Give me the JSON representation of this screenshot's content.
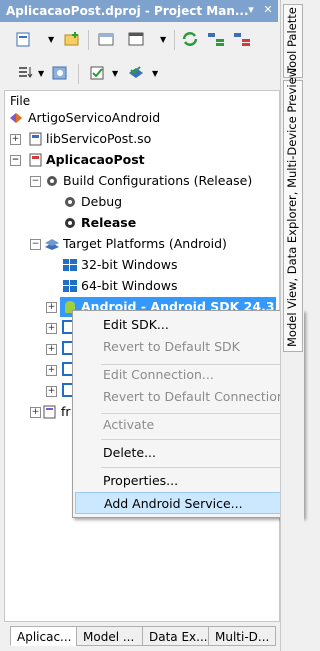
{
  "window": {
    "title": "AplicacaoPost.dproj - Project Man..."
  },
  "toolbar": {
    "icons": [
      "new-item-icon",
      "add-icon",
      "folder-icon",
      "view-icon",
      "sync-icon",
      "expand-icon",
      "collapse-icon",
      "sort-icon",
      "project-manager-icon",
      "build-config-icon",
      "target-platform-icon"
    ]
  },
  "section_label": "File",
  "tree": {
    "root": "ArtigoServicoAndroid",
    "lib": "libServicoPost.so",
    "project": "AplicacaoPost",
    "build_configs": "Build Configurations (Release)",
    "debug": "Debug",
    "release": "Release",
    "target_platforms": "Target Platforms (Android)",
    "win32": "32-bit Windows",
    "win64": "64-bit Windows",
    "android": "Android - Android SDK 24.3.3...",
    "partial_fr": "fr"
  },
  "context_menu": {
    "edit_sdk": "Edit SDK...",
    "revert_sdk": "Revert to Default SDK",
    "edit_connection": "Edit Connection...",
    "revert_connection": "Revert to Default Connection",
    "activate": "Activate",
    "delete": "Delete...",
    "properties": "Properties...",
    "add_service": "Add Android Service..."
  },
  "bottom_tabs": [
    "Aplicac...",
    "Model ...",
    "Data Ex...",
    "Multi-D..."
  ],
  "side_tabs": {
    "tool_palette": "Tool Palette",
    "explorer": "Model View, Data Explorer, Multi-Device Preview"
  },
  "colors": {
    "selection": "#3399ff",
    "title_bar": "#7da2ce",
    "menu_hover": "#cce8ff"
  }
}
